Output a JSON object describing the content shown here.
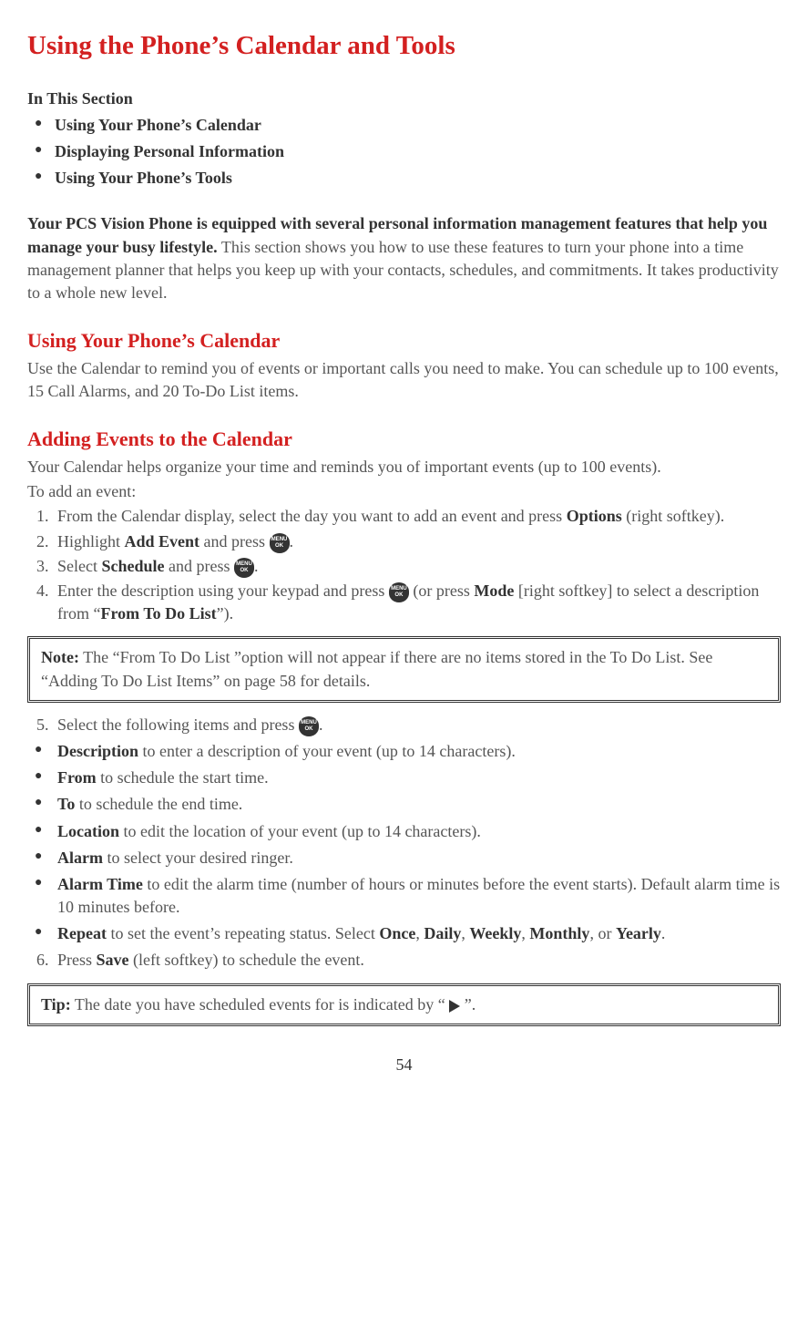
{
  "title": "Using the Phone’s Calendar and Tools",
  "in_this_section_label": "In This Section",
  "section_items": [
    "Using Your Phone’s Calendar",
    "Displaying Personal Information",
    "Using Your Phone’s Tools"
  ],
  "intro": {
    "bold": "Your PCS Vision Phone is equipped with several personal information management features that help you manage your busy lifestyle.",
    "rest": " This section shows you how to use these features to turn your phone into a time management planner that helps you keep up with your contacts, schedules, and commitments. It takes productivity to a whole new level."
  },
  "h2_calendar": "Using Your Phone’s Calendar",
  "calendar_p": "Use the Calendar to remind you of events or important calls you need to make. You can schedule up to 100 events, 15 Call Alarms, and 20 To-Do List items.",
  "h2_adding": "Adding Events to the Calendar",
  "adding_p": "Your Calendar helps organize your time and reminds you of important events (up to 100 events).",
  "to_add_label": "To add an event:",
  "step1_a": "From the Calendar display, select the day you want to add an event and press ",
  "step1_b": "Options",
  "step1_c": " (right softkey).",
  "step2_a": "Highlight ",
  "step2_b": "Add Event",
  "step2_c": " and press ",
  "step2_d": ".",
  "step3_a": "Select ",
  "step3_b": "Schedule",
  "step3_c": " and press ",
  "step3_d": ".",
  "step4_a": "Enter the description using your keypad and press ",
  "step4_b": " (or press ",
  "step4_c": "Mode",
  "step4_d": " [right softkey] to select a description from “",
  "step4_e": "From To Do List",
  "step4_f": "”).",
  "note_label": "Note:",
  "note_text": " The “From To Do List ”option will not appear if there are no items stored in the To Do List. See “Adding To Do List Items” on page 58 for details.",
  "step5_a": "Select the following items and press ",
  "step5_b": ".",
  "items": {
    "desc_b": "Description",
    "desc_t": " to enter a description of your event (up to 14 characters).",
    "from_b": "From",
    "from_t": " to schedule the start time.",
    "to_b": "To",
    "to_t": " to schedule the end time.",
    "loc_b": "Location",
    "loc_t": " to edit the location of your event (up to 14 characters).",
    "alarm_b": "Alarm",
    "alarm_t": " to select your desired ringer.",
    "atime_b": "Alarm Time",
    "atime_t": " to edit the alarm time (number of hours or minutes before the event starts). Default alarm time is 10 minutes before.",
    "repeat_b": "Repeat",
    "repeat_t1": " to set the event’s repeating status. Select ",
    "repeat_once": "Once",
    "repeat_c1": ", ",
    "repeat_daily": "Daily",
    "repeat_c2": ", ",
    "repeat_weekly": "Weekly",
    "repeat_c3": ", ",
    "repeat_monthly": "Monthly",
    "repeat_c4": ", or ",
    "repeat_yearly": "Yearly",
    "repeat_c5": "."
  },
  "step6_a": "Press ",
  "step6_b": "Save",
  "step6_c": " (left softkey) to schedule the event.",
  "tip_label": "Tip:",
  "tip_a": " The date you have scheduled events for is indicated by “ ",
  "tip_b": " ”.",
  "page_number": "54",
  "menu_ok": "MENU\nOK"
}
